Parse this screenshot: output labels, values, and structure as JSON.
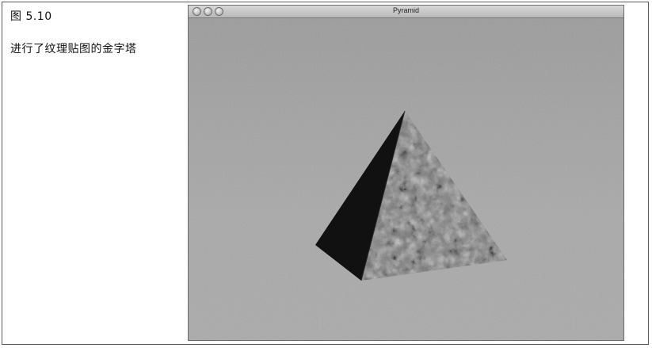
{
  "figure": {
    "label": "图 5.10",
    "description": "进行了纹理贴图的金字塔"
  },
  "window": {
    "title": "Pyramid",
    "buttons": [
      "close",
      "minimize",
      "zoom"
    ]
  },
  "scene": {
    "object": "textured-pyramid",
    "background_color": "#a3a3a3",
    "dark_face_color": "#111111",
    "lit_face_color": "#7d7d7d"
  }
}
